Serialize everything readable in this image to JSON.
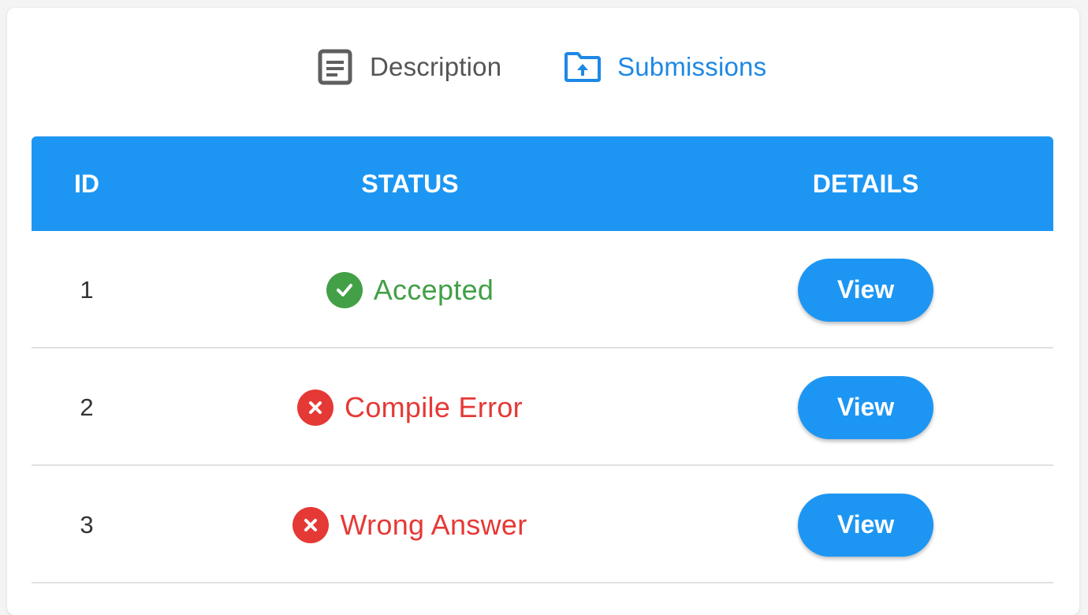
{
  "tabs": {
    "description": {
      "label": "Description",
      "icon": "description-icon"
    },
    "submissions": {
      "label": "Submissions",
      "icon": "folder-upload-icon",
      "active": true
    }
  },
  "table": {
    "headers": {
      "id": "ID",
      "status": "STATUS",
      "details": "DETAILS"
    },
    "rows": [
      {
        "id": "1",
        "status": "Accepted",
        "status_type": "success",
        "action": "View"
      },
      {
        "id": "2",
        "status": "Compile Error",
        "status_type": "error",
        "action": "View"
      },
      {
        "id": "3",
        "status": "Wrong Answer",
        "status_type": "error",
        "action": "View"
      }
    ]
  },
  "colors": {
    "primary": "#1d96f3",
    "success": "#43a047",
    "error": "#e53935",
    "inactive_tab": "#555555"
  }
}
